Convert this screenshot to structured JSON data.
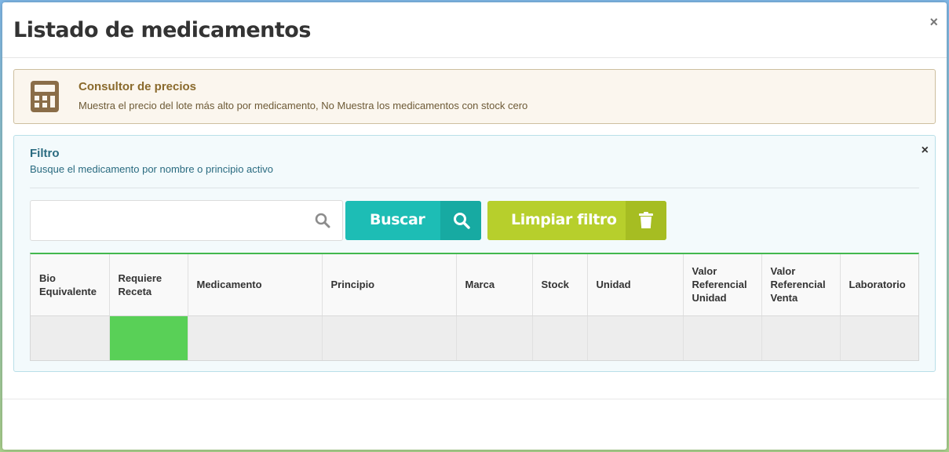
{
  "modal": {
    "title": "Listado de medicamentos",
    "close_label": "×"
  },
  "callout": {
    "icon": "calculator-icon",
    "title": "Consultor de precios",
    "description": "Muestra el precio del lote más alto por medicamento, No Muestra los medicamentos con stock cero",
    "colors": {
      "border": "#cdbf9f",
      "title": "#8a6a2c"
    }
  },
  "filter": {
    "title": "Filtro",
    "subtitle": "Busque el medicamento por nombre o principio activo",
    "close_label": "×",
    "search": {
      "value": "",
      "placeholder": "",
      "icon": "search-icon"
    },
    "buscar_label": "Buscar",
    "limpiar_label": "Limpiar filtro",
    "colors": {
      "buscar": "#1dbdb5",
      "limpiar": "#b7cf2c",
      "table_accent": "#43b84e",
      "requiere_receta_cell": "#59d057"
    }
  },
  "table": {
    "headers": [
      [
        "Bio",
        "Equivalente"
      ],
      [
        "Requiere",
        "Receta"
      ],
      [
        "Medicamento"
      ],
      [
        "Principio"
      ],
      [
        "Marca"
      ],
      [
        "Stock"
      ],
      [
        "Unidad"
      ],
      [
        "Valor",
        "Referencial",
        "Unidad"
      ],
      [
        "Valor",
        "Referencial",
        "Venta"
      ],
      [
        "Laboratorio"
      ]
    ]
  }
}
